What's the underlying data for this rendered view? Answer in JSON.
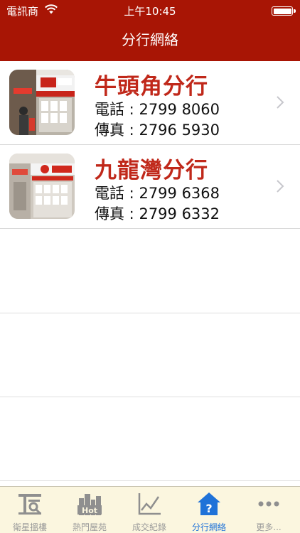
{
  "status_bar": {
    "carrier": "電訊商",
    "time": "上午10:45"
  },
  "nav": {
    "title": "分行網絡"
  },
  "branches": [
    {
      "name": "牛頭角分行",
      "tel_label": "電話 :",
      "tel": "2799 8060",
      "fax_label": "傳真 :",
      "fax": "2796 5930"
    },
    {
      "name": "九龍灣分行",
      "tel_label": "電話 :",
      "tel": "2799 6368",
      "fax_label": "傳真 :",
      "fax": "2799 6332"
    }
  ],
  "tabs": [
    {
      "label": "衛星搵樓",
      "icon": "satellite-map-icon",
      "active": false
    },
    {
      "label": "熱門屋苑",
      "icon": "hot-buildings-icon",
      "active": false
    },
    {
      "label": "成交紀錄",
      "icon": "line-chart-icon",
      "active": false
    },
    {
      "label": "分行網絡",
      "icon": "question-house-icon",
      "active": true
    },
    {
      "label": "更多...",
      "icon": "more-dots-icon",
      "active": false
    }
  ],
  "colors": {
    "nav_bar": "#a81505",
    "branch_name": "#c0281a",
    "tab_active": "#1f72d8",
    "tab_inactive": "#9a9a9a",
    "tab_bar_bg": "#fbf6df"
  }
}
